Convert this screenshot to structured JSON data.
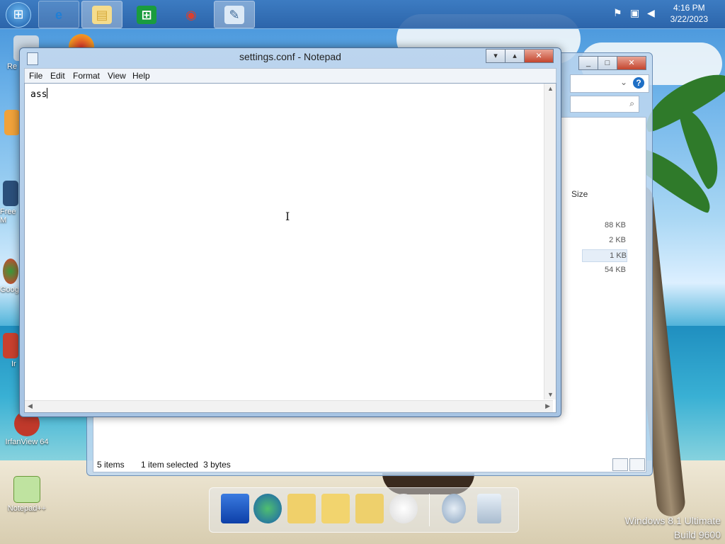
{
  "taskbar": {
    "clock_time": "4:16 PM",
    "clock_date": "3/22/2023",
    "pinned": [
      {
        "name": "internet-explorer-icon",
        "glyph": "e",
        "color": "#1f7fd6"
      },
      {
        "name": "file-explorer-icon",
        "glyph": "▤",
        "color": "#e8c35a"
      },
      {
        "name": "store-icon",
        "glyph": "⊞",
        "color": "#1a9c3e"
      },
      {
        "name": "chrome-icon",
        "glyph": "◉",
        "color": "#d84030"
      },
      {
        "name": "notepad-icon",
        "glyph": "✎",
        "color": "#8fb2d6"
      }
    ]
  },
  "desktop_icons": {
    "icon1": "Re",
    "icon2": "Free\nM",
    "icon3": "Goog",
    "icon4": "Ir",
    "irfanview": "IrfanView 64",
    "notepadpp": "Notepad++"
  },
  "explorer": {
    "size_header": "Size",
    "sizes": [
      "88 KB",
      "2 KB",
      "1 KB",
      "54 KB"
    ],
    "status_items": "5 items",
    "status_selected": "1 item selected",
    "status_size": "3 bytes"
  },
  "notepad": {
    "title": "settings.conf - Notepad",
    "menu": [
      "File",
      "Edit",
      "Format",
      "View",
      "Help"
    ],
    "content": "ass"
  },
  "watermark": {
    "line1": "Windows 8.1 Ultimate",
    "line2": "Build 9600"
  }
}
